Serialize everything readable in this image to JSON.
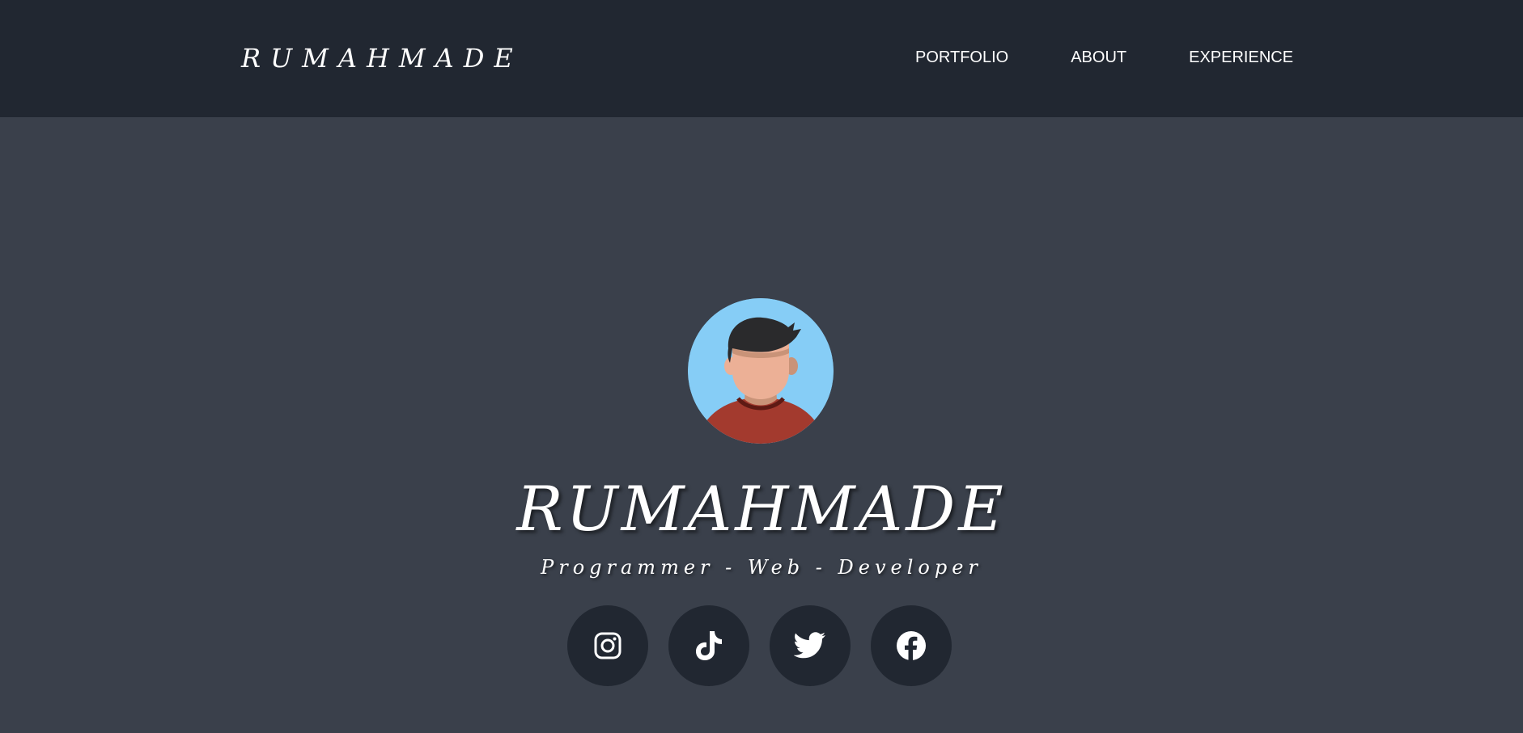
{
  "navbar": {
    "brand": "RUMAHMADE",
    "links": [
      {
        "label": "PORTFOLIO"
      },
      {
        "label": "ABOUT"
      },
      {
        "label": "EXPERIENCE"
      }
    ]
  },
  "hero": {
    "avatar": "avatar-illustration",
    "title": "RUMAHMADE",
    "subtitle": "Programmer - Web - Developer",
    "socials": [
      {
        "icon": "instagram-icon"
      },
      {
        "icon": "tiktok-icon"
      },
      {
        "icon": "twitter-icon"
      },
      {
        "icon": "facebook-icon"
      }
    ]
  },
  "colors": {
    "navbar_bg": "#212731",
    "page_bg": "#3a404b",
    "avatar_bg": "#86cdf6",
    "shirt": "#a33a2e",
    "skin": "#ecb096",
    "hair": "#2a2a2c",
    "text": "#ffffff"
  }
}
